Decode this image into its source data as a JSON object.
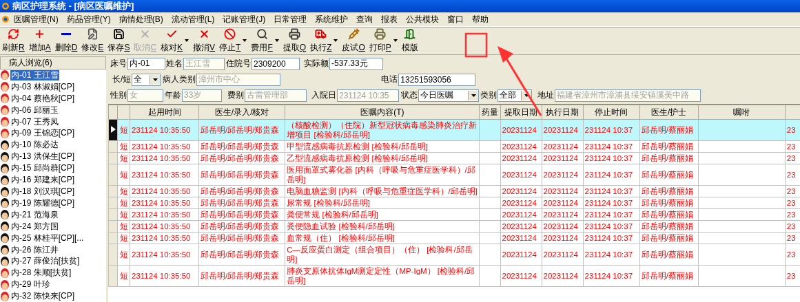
{
  "window": {
    "title": "病区护理系统 - [病区医嘱维护]"
  },
  "menu": [
    "医嘱管理(N)",
    "药品管理(Y)",
    "病情处理(B)",
    "流动管理(L)",
    "记账管理(J)",
    "日常管理",
    "系统维护",
    "查询",
    "报表",
    "公共模块",
    "窗口",
    "帮助"
  ],
  "toolbar": [
    {
      "label": "刷新",
      "key": "R",
      "disabled": false,
      "dropdown": false
    },
    {
      "label": "增加",
      "key": "A",
      "disabled": false,
      "dropdown": false
    },
    {
      "label": "删除",
      "key": "D",
      "disabled": false,
      "dropdown": false
    },
    {
      "label": "修改",
      "key": "E",
      "disabled": false,
      "dropdown": false
    },
    {
      "label": "保存",
      "key": "S",
      "disabled": false,
      "dropdown": false
    },
    {
      "label": "取消",
      "key": "C",
      "disabled": true,
      "dropdown": false
    },
    {
      "label": "核对",
      "key": "K",
      "disabled": false,
      "dropdown": true
    },
    {
      "label": "撤消",
      "key": "V",
      "disabled": false,
      "dropdown": false
    },
    {
      "label": "停止",
      "key": "T",
      "disabled": false,
      "dropdown": true
    },
    {
      "label": "费用",
      "key": "F",
      "disabled": false,
      "dropdown": true
    },
    {
      "label": "提取",
      "key": "Q",
      "disabled": false,
      "dropdown": false
    },
    {
      "label": "执行",
      "key": "Z",
      "disabled": false,
      "dropdown": true
    },
    {
      "label": "皮试",
      "key": "O",
      "disabled": false,
      "dropdown": false
    },
    {
      "label": "打印",
      "key": "P",
      "disabled": false,
      "dropdown": true
    },
    {
      "label": "模版",
      "disabled": false,
      "dropdown": false
    }
  ],
  "sidebar": {
    "title": "病人浏览(6)",
    "items": [
      {
        "label": "内-01 王江雪",
        "kind": "female",
        "selected": true
      },
      {
        "label": "内-03 林淑娟[CP]",
        "kind": "female",
        "selected": false
      },
      {
        "label": "内-04 蔡艳秋[CP]",
        "kind": "female",
        "selected": false
      },
      {
        "label": "内-06 邱丽玉",
        "kind": "female",
        "selected": false
      },
      {
        "label": "内-07 王秀凤",
        "kind": "female",
        "selected": false
      },
      {
        "label": "内-09 王锦恋[CP]",
        "kind": "female",
        "selected": false
      },
      {
        "label": "内-10 陈必达",
        "kind": "male",
        "selected": false
      },
      {
        "label": "内-13 洪保生[CP]",
        "kind": "male",
        "selected": false
      },
      {
        "label": "内-15 邱尚群[CP]",
        "kind": "male",
        "selected": false
      },
      {
        "label": "内-16 郑建来[CP]",
        "kind": "male",
        "selected": false
      },
      {
        "label": "内-18 刘汉琪[CP]",
        "kind": "male",
        "selected": false
      },
      {
        "label": "内-19 陈耀德[CP]",
        "kind": "male",
        "selected": false
      },
      {
        "label": "内-21 范海泉",
        "kind": "male",
        "selected": false
      },
      {
        "label": "内-24 郑方国",
        "kind": "male",
        "selected": false
      },
      {
        "label": "内-25 林桂平[CP][...",
        "kind": "male",
        "selected": false
      },
      {
        "label": "内-26 陈江井",
        "kind": "male",
        "selected": false
      },
      {
        "label": "内-27 薛俊治[扶贫]",
        "kind": "male",
        "selected": false
      },
      {
        "label": "内-28 朱顺[扶贫]",
        "kind": "female",
        "selected": false
      },
      {
        "label": "内-29 叶珍",
        "kind": "female",
        "selected": false
      },
      {
        "label": "内-32 陈快来[CP]",
        "kind": "female",
        "selected": false
      }
    ]
  },
  "form": [
    [
      {
        "label": "床号",
        "value": "内-01",
        "kind": "input",
        "readonly": false
      },
      {
        "label": "姓名",
        "value": "王江雪",
        "kind": "input",
        "readonly": true
      },
      {
        "label": "住院号",
        "value": "2309200",
        "kind": "input",
        "readonly": false
      },
      {
        "label": "实际额",
        "value": "-537.33元",
        "kind": "input",
        "readonly": false
      }
    ],
    [
      {
        "label": "长/短",
        "value": "全",
        "kind": "select",
        "readonly": false
      },
      {
        "label": "病人类别",
        "value": "漳州市中心",
        "kind": "input",
        "readonly": true
      },
      {
        "label": "电话",
        "value": "13251593056",
        "kind": "input",
        "readonly": false
      }
    ],
    [
      {
        "label": "性别",
        "value": "女",
        "kind": "input",
        "readonly": true
      },
      {
        "label": "年龄",
        "value": "33岁",
        "kind": "input",
        "readonly": true
      },
      {
        "label": "费别",
        "value": "古雷管理部",
        "kind": "input",
        "readonly": true
      },
      {
        "label": "入院日",
        "value": "231124 10:35",
        "kind": "input",
        "readonly": true
      },
      {
        "label": "状态",
        "value": "今日医嘱",
        "kind": "select",
        "readonly": false
      },
      {
        "label": "类别",
        "value": "全部",
        "kind": "select",
        "readonly": false
      },
      {
        "label": "地址",
        "value": "福建省漳州市漳浦县绥安镇溪美中路",
        "kind": "input",
        "readonly": true
      }
    ]
  ],
  "table": {
    "columns": [
      "",
      "起用时间",
      "医生/录入/核对",
      "医嘱内容(T)",
      "药量",
      "提取日期",
      "执行日期",
      "停止时间",
      "医生/护士",
      "嘱咐",
      ""
    ],
    "rows": [
      {
        "selected": true,
        "type": "短",
        "start": "231124 10:35:50",
        "doctors": "邱岳明/邱岳明/郑贵森",
        "content": "（核酸检测）（住院）新型冠状病毒感染肺炎治疗新增项目 [检验科/邱岳明]",
        "extract": "20231124",
        "execute": "20231124",
        "stop": "231124 10:37",
        "staff": "邱岳明/蔡丽娟",
        "column_12": "23"
      },
      {
        "selected": false,
        "type": "短",
        "start": "231124 10:35:50",
        "doctors": "邱岳明/邱岳明/郑贵森",
        "content": "甲型流感病毒抗原检测 [检验科/邱岳明]",
        "extract": "20231124",
        "execute": "20231124",
        "stop": "231124 10:37",
        "staff": "邱岳明/蔡丽娟",
        "column_12": "23"
      },
      {
        "selected": false,
        "type": "短",
        "start": "231124 10:35:50",
        "doctors": "邱岳明/邱岳明/郑贵森",
        "content": "乙型流感病毒抗原检测 [检验科/邱岳明]",
        "extract": "20231124",
        "execute": "20231124",
        "stop": "231124 10:37",
        "staff": "邱岳明/蔡丽娟",
        "column_12": "23"
      },
      {
        "selected": false,
        "type": "短",
        "start": "231124 10:35:50",
        "doctors": "邱岳明/邱岳明/郑贵森",
        "content": "医用面罩式雾化器 [内科（呼吸与危重症医学科）/邱岳明]",
        "extract": "20231124",
        "execute": "20231124",
        "stop": "231124 10:37",
        "staff": "邱岳明/蔡丽娟",
        "column_12": "23"
      },
      {
        "selected": false,
        "type": "短",
        "start": "231124 10:35:50",
        "doctors": "邱岳明/邱岳明/郑贵森",
        "content": "电脑血糖监测 [内科（呼吸与危重症医学科）/邱岳明]",
        "extract": "20231124",
        "execute": "20231124",
        "stop": "231124 10:37",
        "staff": "邱岳明/蔡丽娟",
        "column_12": "23"
      },
      {
        "selected": false,
        "type": "短",
        "start": "231124 10:35:50",
        "doctors": "邱岳明/邱岳明/郑贵森",
        "content": "尿常规 [检验科/邱岳明]",
        "extract": "20231124",
        "execute": "20231124",
        "stop": "231124 10:37",
        "staff": "邱岳明/蔡丽娟",
        "column_12": "23"
      },
      {
        "selected": false,
        "type": "短",
        "start": "231124 10:35:50",
        "doctors": "邱岳明/邱岳明/郑贵森",
        "content": "粪便常规 [检验科/邱岳明]",
        "extract": "20231124",
        "execute": "20231124",
        "stop": "231124 10:37",
        "staff": "邱岳明/蔡丽娟",
        "column_12": "23"
      },
      {
        "selected": false,
        "type": "短",
        "start": "231124 10:35:50",
        "doctors": "邱岳明/邱岳明/郑贵森",
        "content": "粪便隐血试验 [检验科/邱岳明]",
        "extract": "20231124",
        "execute": "20231124",
        "stop": "231124 10:37",
        "staff": "邱岳明/蔡丽娟",
        "column_12": "23"
      },
      {
        "selected": false,
        "type": "短",
        "start": "231124 10:35:50",
        "doctors": "邱岳明/邱岳明/郑贵森",
        "content": "血常规（住） [检验科/邱岳明]",
        "extract": "20231124",
        "execute": "20231124",
        "stop": "231124 10:37",
        "staff": "邱岳明/蔡丽娟",
        "column_12": "23"
      },
      {
        "selected": false,
        "type": "短",
        "start": "231124 10:35:50",
        "doctors": "邱岳明/邱岳明/郑贵森",
        "content": "C—反应蛋白测定（组合项目）（住） [检验科/邱岳明]",
        "extract": "20231124",
        "execute": "20231124",
        "stop": "231124 10:37",
        "staff": "邱岳明/蔡丽娟",
        "column_12": "23"
      },
      {
        "selected": false,
        "type": "短",
        "start": "231124 10:35:50",
        "doctors": "邱岳明/邱岳明/郑贵森",
        "content": "肺炎支原体抗体IgM测定定性（MP-IgM） [检验科/邱岳明]",
        "extract": "20231124",
        "execute": "20231124",
        "stop": "231124 10:37",
        "staff": "邱岳明/蔡丽娟",
        "column_12": "23"
      }
    ]
  }
}
